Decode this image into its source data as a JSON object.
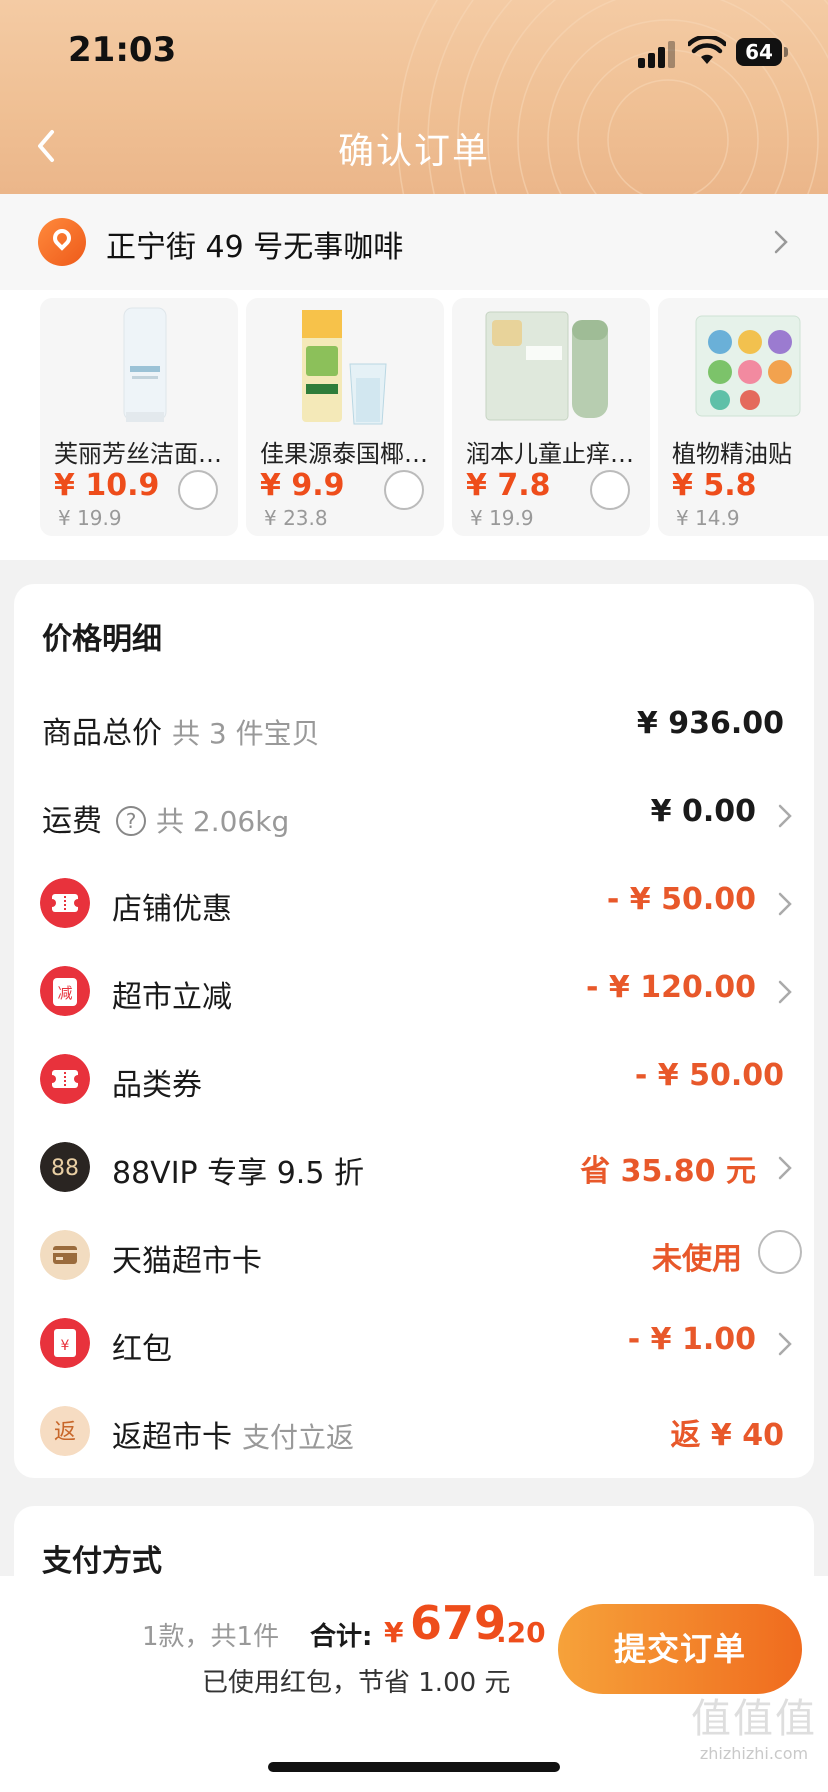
{
  "status": {
    "time": "21:03",
    "battery": "64"
  },
  "header": {
    "title": "确认订单"
  },
  "address": {
    "text": "正宁街 49 号无事咖啡"
  },
  "products": [
    {
      "name": "芙丽芳丝洁面…",
      "price": "¥ 10.9",
      "orig": "¥ 19.9"
    },
    {
      "name": "佳果源泰国椰…",
      "price": "¥ 9.9",
      "orig": "¥ 23.8"
    },
    {
      "name": "润本儿童止痒…",
      "price": "¥ 7.8",
      "orig": "¥ 19.9"
    },
    {
      "name": "植物精油贴",
      "price": "¥ 5.8",
      "orig": "¥ 14.9"
    }
  ],
  "price_details": {
    "title": "价格明细",
    "rows": [
      {
        "label": "商品总价",
        "sub": "共 3 件宝贝",
        "value": "¥ 936.00"
      },
      {
        "label": "运费",
        "sub": "共 2.06kg",
        "value": "¥ 0.00"
      },
      {
        "label": "店铺优惠",
        "value": "- ¥ 50.00"
      },
      {
        "label": "超市立减",
        "value": "- ¥ 120.00"
      },
      {
        "label": "品类券",
        "value": "- ¥ 50.00"
      },
      {
        "label": "88VIP 专享 9.5 折",
        "value": "省 35.80 元"
      },
      {
        "label": "天猫超市卡",
        "value": "未使用"
      },
      {
        "label": "红包",
        "value": "- ¥ 1.00"
      },
      {
        "label": "返超市卡",
        "sub": "支付立返",
        "value": "返 ¥ 40"
      }
    ],
    "icon_texts": {
      "jian": "减",
      "vip": "88",
      "hongbao": "¥",
      "fan": "返"
    }
  },
  "payment": {
    "title": "支付方式"
  },
  "bottom": {
    "count": "1款，共1件",
    "total_label": "合计:",
    "currency": "¥",
    "total_int": "679",
    "total_dec": ".20",
    "saved": "已使用红包，节省 1.00 元",
    "submit": "提交订单"
  },
  "watermark": {
    "text": "值值值",
    "sub": "zhizhizhi.com"
  },
  "colors": {
    "accent": "#ee4d1b",
    "discount": "#e8582a",
    "header": "#efbf93"
  }
}
